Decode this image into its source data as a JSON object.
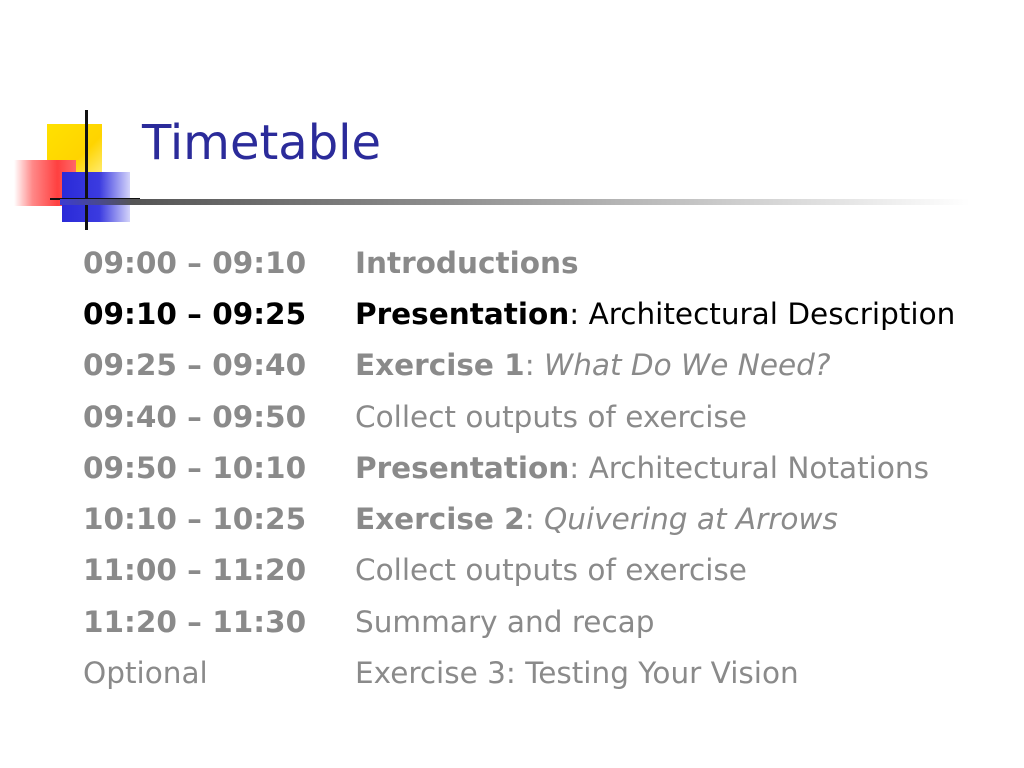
{
  "slide": {
    "title": "Timetable",
    "colors": {
      "title": "#2b2b9a",
      "current_row": "#000000",
      "other_rows": "#8a8a8a",
      "logo_yellow": "#ffd400",
      "logo_red": "#ff4040",
      "logo_blue": "#2a2ad8"
    }
  },
  "rows": [
    {
      "time": "09:00 – 09:10",
      "head": "Introductions",
      "sep": "",
      "tail": ""
    },
    {
      "time": "09:10 – 09:25",
      "head": "Presentation",
      "sep": ":",
      "tail": " Architectural Description"
    },
    {
      "time": "09:25 – 09:40",
      "head": "Exercise 1",
      "sep": ":",
      "tail": " What Do We Need?"
    },
    {
      "time": "09:40 – 09:50",
      "head": "",
      "sep": "",
      "tail": "Collect outputs of exercise"
    },
    {
      "time": "09:50 – 10:10",
      "head": "Presentation",
      "sep": ":",
      "tail": " Architectural Notations"
    },
    {
      "time": "10:10 – 10:25",
      "head": "Exercise 2",
      "sep": ":",
      "tail": " Quivering at Arrows"
    },
    {
      "time": "11:00 – 11:20",
      "head": "",
      "sep": "",
      "tail": "Collect outputs of exercise"
    },
    {
      "time": "11:20 – 11:30",
      "head": "",
      "sep": "",
      "tail": "Summary and recap"
    },
    {
      "time": "Optional",
      "head": "",
      "sep": "",
      "tail": "Exercise 3: Testing Your Vision"
    }
  ]
}
